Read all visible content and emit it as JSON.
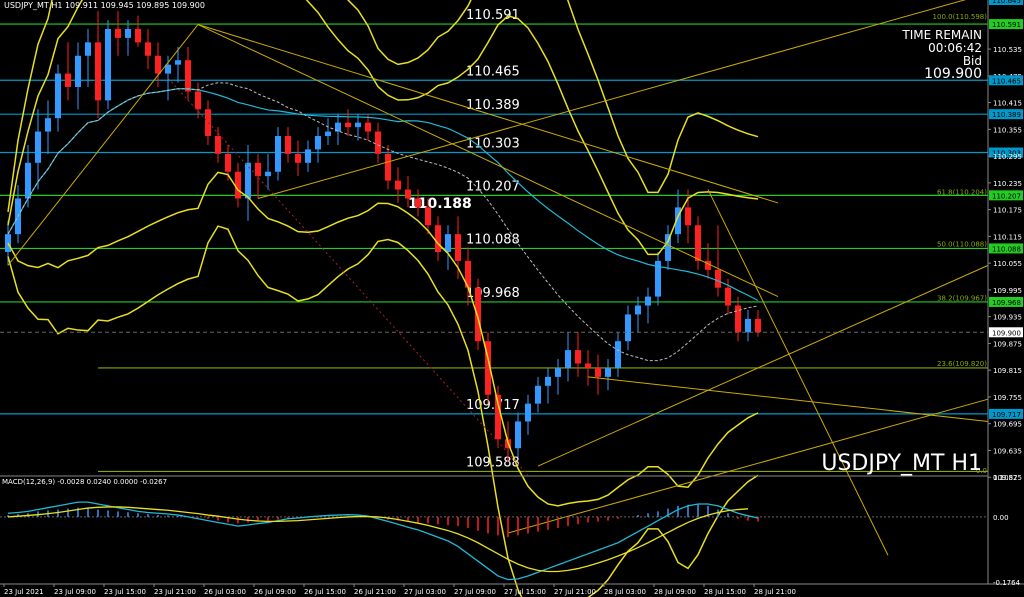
{
  "header": {
    "symbol_info": "USDJPY_MT,H1  109.911 109.945 109.895 109.900"
  },
  "info": {
    "time_remain_label": "TIME REMAIN",
    "time_remain_value": "00:06:42",
    "bid_label": "Bid",
    "bid_value": "109.900"
  },
  "watermark": "USDJPY_MT H1",
  "colors": {
    "background": "#000000",
    "bull": "#3399ff",
    "bear": "#ff2020",
    "hline_green": "#22cc22",
    "hline_cyan": "#0099cc",
    "fibo": "#88aa00",
    "bollinger": "#e8e020",
    "trend": "#ccaa00",
    "ma_blue": "#1fb8d8",
    "macd_line": "#1fb8d8",
    "signal_line": "#e8e020",
    "axis_text": "#ffffff"
  },
  "price_labels": {
    "levels": [
      {
        "text": "110.591",
        "price": 110.591
      },
      {
        "text": "110.465",
        "price": 110.465
      },
      {
        "text": "110.389",
        "price": 110.389
      },
      {
        "text": "110.303",
        "price": 110.303
      },
      {
        "text": "110.207",
        "price": 110.207
      },
      {
        "text": "110.088",
        "price": 110.088
      },
      {
        "text": "109.968",
        "price": 109.968
      },
      {
        "text": "109.717",
        "price": 109.717
      },
      {
        "text": "109.588",
        "price": 109.588
      }
    ],
    "highlight": {
      "text": "110.188",
      "price": 110.188
    }
  },
  "chart_data": [
    {
      "type": "candlestick",
      "title": "USDJPY_MT,H1",
      "ylim": [
        109.58,
        110.645
      ],
      "y_ticks": [
        "110.645",
        "110.591",
        "110.535",
        "110.475",
        "110.465",
        "110.415",
        "110.389",
        "110.355",
        "110.303",
        "110.295",
        "110.235",
        "110.207",
        "110.175",
        "110.115",
        "110.088",
        "110.055",
        "109.995",
        "109.968",
        "109.935",
        "109.900",
        "109.875",
        "109.815",
        "109.755",
        "109.717",
        "109.695",
        "109.635",
        "109.575"
      ],
      "x_labels": [
        "23 Jul 2021",
        "23 Jul 09:00",
        "23 Jul 15:00",
        "23 Jul 21:00",
        "26 Jul 03:00",
        "26 Jul 09:00",
        "26 Jul 15:00",
        "26 Jul 21:00",
        "27 Jul 03:00",
        "27 Jul 09:00",
        "27 Jul 15:00",
        "27 Jul 21:00",
        "28 Jul 03:00",
        "28 Jul 09:00",
        "28 Jul 15:00",
        "28 Jul 21:00"
      ],
      "horizontal_levels": [
        {
          "price": 110.591,
          "style": "green"
        },
        {
          "price": 110.465,
          "style": "cyan"
        },
        {
          "price": 110.389,
          "style": "cyan"
        },
        {
          "price": 110.303,
          "style": "cyan"
        },
        {
          "price": 110.207,
          "style": "green"
        },
        {
          "price": 110.088,
          "style": "green"
        },
        {
          "price": 109.968,
          "style": "green"
        },
        {
          "price": 109.82,
          "style": "fibo"
        },
        {
          "price": 109.717,
          "style": "cyan"
        },
        {
          "price": 109.588,
          "style": "fibo"
        }
      ],
      "fibo_labels": [
        {
          "text": "100.0(110.598)",
          "price": 110.598
        },
        {
          "text": "61.8(110.204)",
          "price": 110.204
        },
        {
          "text": "50.0(110.088)",
          "price": 110.088
        },
        {
          "text": "38.2(109.967)",
          "price": 109.967
        },
        {
          "text": "23.6(109.820)",
          "price": 109.82
        },
        {
          "text": "0.0",
          "price": 109.58
        }
      ],
      "current_price": 109.9,
      "axis_highlights": [
        "110.645",
        "110.591",
        "110.465",
        "110.389",
        "110.303",
        "110.207",
        "110.088",
        "109.968",
        "109.900",
        "109.717"
      ],
      "candles": [
        [
          110.08,
          110.15,
          110.05,
          110.12
        ],
        [
          110.12,
          110.23,
          110.1,
          110.2
        ],
        [
          110.2,
          110.32,
          110.18,
          110.28
        ],
        [
          110.28,
          110.4,
          110.22,
          110.35
        ],
        [
          110.35,
          110.42,
          110.3,
          110.38
        ],
        [
          110.38,
          110.5,
          110.35,
          110.48
        ],
        [
          110.48,
          110.55,
          110.42,
          110.45
        ],
        [
          110.45,
          110.55,
          110.4,
          110.52
        ],
        [
          110.52,
          110.58,
          110.45,
          110.55
        ],
        [
          110.55,
          110.62,
          110.38,
          110.42
        ],
        [
          110.42,
          110.6,
          110.4,
          110.58
        ],
        [
          110.58,
          110.62,
          110.52,
          110.56
        ],
        [
          110.56,
          110.6,
          110.52,
          110.58
        ],
        [
          110.58,
          110.61,
          110.54,
          110.55
        ],
        [
          110.55,
          110.58,
          110.49,
          110.52
        ],
        [
          110.52,
          110.55,
          110.45,
          110.48
        ],
        [
          110.48,
          110.52,
          110.42,
          110.5
        ],
        [
          110.5,
          110.54,
          110.46,
          110.51
        ],
        [
          110.51,
          110.54,
          110.42,
          110.44
        ],
        [
          110.44,
          110.46,
          110.38,
          110.4
        ],
        [
          110.4,
          110.42,
          110.32,
          110.34
        ],
        [
          110.34,
          110.36,
          110.28,
          110.3
        ],
        [
          110.3,
          110.32,
          110.24,
          110.26
        ],
        [
          110.26,
          110.28,
          110.18,
          110.2
        ],
        [
          110.2,
          110.32,
          110.15,
          110.28
        ],
        [
          110.28,
          110.3,
          110.2,
          110.25
        ],
        [
          110.25,
          110.3,
          110.22,
          110.26
        ],
        [
          110.26,
          110.36,
          110.24,
          110.34
        ],
        [
          110.34,
          110.36,
          110.28,
          110.3
        ],
        [
          110.3,
          110.33,
          110.25,
          110.28
        ],
        [
          110.28,
          110.33,
          110.26,
          110.31
        ],
        [
          110.31,
          110.36,
          110.28,
          110.34
        ],
        [
          110.34,
          110.38,
          110.32,
          110.35
        ],
        [
          110.35,
          110.39,
          110.32,
          110.37
        ],
        [
          110.37,
          110.4,
          110.34,
          110.36
        ],
        [
          110.36,
          110.39,
          110.33,
          110.37
        ],
        [
          110.37,
          110.39,
          110.33,
          110.35
        ],
        [
          110.35,
          110.37,
          110.28,
          110.3
        ],
        [
          110.3,
          110.32,
          110.22,
          110.24
        ],
        [
          110.24,
          110.27,
          110.19,
          110.22
        ],
        [
          110.22,
          110.25,
          110.18,
          110.2
        ],
        [
          110.2,
          110.22,
          110.16,
          110.18
        ],
        [
          110.18,
          110.2,
          110.12,
          110.14
        ],
        [
          110.14,
          110.16,
          110.06,
          110.08
        ],
        [
          110.08,
          110.14,
          110.04,
          110.12
        ],
        [
          110.12,
          110.16,
          110.02,
          110.06
        ],
        [
          110.06,
          110.09,
          109.96,
          110.0
        ],
        [
          110.0,
          110.02,
          109.86,
          109.88
        ],
        [
          109.88,
          109.9,
          109.74,
          109.76
        ],
        [
          109.76,
          109.78,
          109.64,
          109.66
        ],
        [
          109.66,
          109.7,
          109.61,
          109.64
        ],
        [
          109.64,
          109.72,
          109.62,
          109.7
        ],
        [
          109.7,
          109.76,
          109.67,
          109.74
        ],
        [
          109.74,
          109.8,
          109.72,
          109.78
        ],
        [
          109.78,
          109.82,
          109.74,
          109.8
        ],
        [
          109.8,
          109.84,
          109.76,
          109.82
        ],
        [
          109.82,
          109.9,
          109.79,
          109.86
        ],
        [
          109.86,
          109.9,
          109.8,
          109.83
        ],
        [
          109.83,
          109.86,
          109.78,
          109.82
        ],
        [
          109.82,
          109.85,
          109.76,
          109.8
        ],
        [
          109.8,
          109.84,
          109.77,
          109.82
        ],
        [
          109.82,
          109.9,
          109.8,
          109.88
        ],
        [
          109.88,
          109.96,
          109.86,
          109.94
        ],
        [
          109.94,
          109.98,
          109.9,
          109.96
        ],
        [
          109.96,
          110.0,
          109.92,
          109.98
        ],
        [
          109.98,
          110.08,
          109.96,
          110.06
        ],
        [
          110.06,
          110.14,
          110.04,
          110.12
        ],
        [
          110.12,
          110.22,
          110.1,
          110.18
        ],
        [
          110.18,
          110.22,
          110.1,
          110.14
        ],
        [
          110.14,
          110.16,
          110.04,
          110.06
        ],
        [
          110.06,
          110.1,
          110.02,
          110.04
        ],
        [
          110.04,
          110.14,
          109.98,
          110.0
        ],
        [
          110.0,
          110.02,
          109.94,
          109.96
        ],
        [
          109.96,
          109.98,
          109.88,
          109.9
        ],
        [
          109.9,
          109.95,
          109.88,
          109.93
        ],
        [
          109.93,
          109.95,
          109.89,
          109.9
        ]
      ]
    },
    {
      "type": "histogram",
      "title": "MACD(12,26,9) -0.0028 0.0240 0.0000 -0.0267",
      "ylim": [
        -0.1764,
        0.1082
      ],
      "y_ticks": [
        "0.1082",
        "0.00",
        "-0.1764"
      ],
      "series": [
        {
          "kind": "histogram",
          "values": [
            0.01,
            0.015,
            0.02,
            0.03,
            0.035,
            0.04,
            0.045,
            0.05,
            0.048,
            0.04,
            0.035,
            0.03,
            0.025,
            0.02,
            0.015,
            0.01,
            0.008,
            0.005,
            0.0,
            -0.005,
            -0.01,
            -0.02,
            -0.03,
            -0.035,
            -0.03,
            -0.025,
            -0.02,
            -0.015,
            -0.01,
            -0.008,
            -0.005,
            -0.003,
            0.0,
            0.002,
            0.004,
            0.003,
            0.0,
            -0.008,
            -0.015,
            -0.02,
            -0.025,
            -0.03,
            -0.035,
            -0.04,
            -0.045,
            -0.05,
            -0.06,
            -0.075,
            -0.09,
            -0.1,
            -0.11,
            -0.1,
            -0.09,
            -0.08,
            -0.07,
            -0.06,
            -0.05,
            -0.04,
            -0.03,
            -0.025,
            -0.02,
            -0.01,
            0.0,
            0.01,
            0.02,
            0.03,
            0.045,
            0.06,
            0.065,
            0.07,
            0.06,
            0.04,
            0.02,
            -0.01,
            -0.02,
            -0.025
          ]
        },
        {
          "kind": "macd",
          "values": [
            0.01,
            0.012,
            0.015,
            0.02,
            0.025,
            0.03,
            0.035,
            0.04,
            0.04,
            0.035,
            0.03,
            0.025,
            0.02,
            0.015,
            0.012,
            0.01,
            0.008,
            0.005,
            0.0,
            -0.005,
            -0.01,
            -0.015,
            -0.02,
            -0.025,
            -0.022,
            -0.018,
            -0.015,
            -0.01,
            -0.005,
            -0.003,
            0.0,
            0.002,
            0.004,
            0.005,
            0.006,
            0.005,
            0.002,
            -0.005,
            -0.012,
            -0.02,
            -0.028,
            -0.035,
            -0.045,
            -0.055,
            -0.065,
            -0.08,
            -0.1,
            -0.12,
            -0.14,
            -0.16,
            -0.17,
            -0.168,
            -0.16,
            -0.15,
            -0.14,
            -0.13,
            -0.12,
            -0.11,
            -0.1,
            -0.09,
            -0.08,
            -0.07,
            -0.055,
            -0.04,
            -0.025,
            -0.01,
            0.005,
            0.02,
            0.03,
            0.035,
            0.035,
            0.03,
            0.02,
            0.01,
            0.003,
            -0.003
          ]
        },
        {
          "kind": "signal",
          "values": [
            0.0,
            0.002,
            0.004,
            0.006,
            0.009,
            0.012,
            0.016,
            0.02,
            0.024,
            0.026,
            0.027,
            0.027,
            0.026,
            0.024,
            0.022,
            0.02,
            0.018,
            0.015,
            0.012,
            0.009,
            0.005,
            0.002,
            -0.002,
            -0.006,
            -0.009,
            -0.011,
            -0.012,
            -0.012,
            -0.011,
            -0.01,
            -0.008,
            -0.006,
            -0.004,
            -0.002,
            0.0,
            0.001,
            0.001,
            0.0,
            -0.003,
            -0.007,
            -0.012,
            -0.017,
            -0.023,
            -0.03,
            -0.037,
            -0.046,
            -0.057,
            -0.07,
            -0.085,
            -0.1,
            -0.115,
            -0.128,
            -0.138,
            -0.145,
            -0.148,
            -0.148,
            -0.145,
            -0.14,
            -0.133,
            -0.125,
            -0.116,
            -0.106,
            -0.095,
            -0.083,
            -0.07,
            -0.056,
            -0.042,
            -0.028,
            -0.015,
            -0.004,
            0.005,
            0.012,
            0.017,
            0.02,
            0.022,
            0.0
          ]
        }
      ]
    }
  ]
}
